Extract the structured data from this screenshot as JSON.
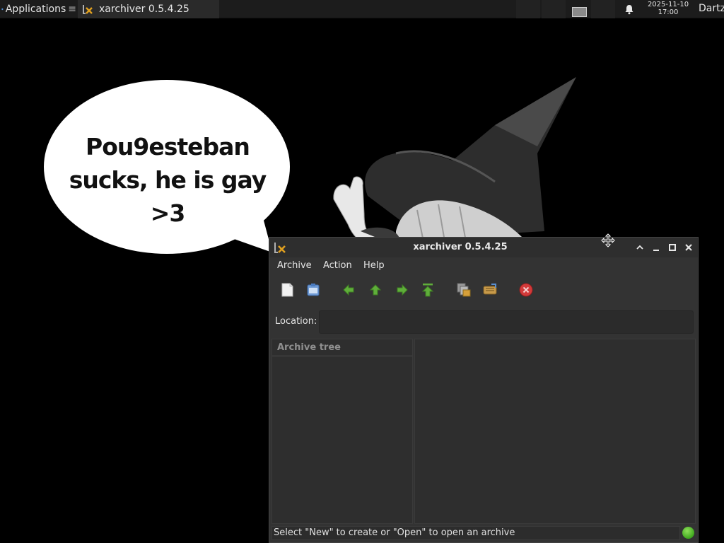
{
  "panel": {
    "apps_label": "Applications",
    "task_title": "xarchiver 0.5.4.25",
    "clock_date": "2025-11-10",
    "clock_time": "17:00",
    "user": "Dartz"
  },
  "wallpaper": {
    "bubble_line1": "Pou9esteban",
    "bubble_line2": "sucks, he is gay >3"
  },
  "window": {
    "title": "xarchiver 0.5.4.25",
    "menu": {
      "archive": "Archive",
      "action": "Action",
      "help": "Help"
    },
    "location_label": "Location:",
    "location_value": "",
    "tree_header": "Archive tree",
    "status_text": "Select \"New\" to create or \"Open\" to open an archive"
  },
  "icons": {
    "new": "new-archive-icon",
    "open": "open-archive-icon",
    "back": "back-arrow-icon",
    "up": "up-arrow-icon",
    "forward": "forward-arrow-icon",
    "home": "home-icon",
    "extract": "extract-icon",
    "add": "add-files-icon",
    "stop": "stop-icon"
  },
  "colors": {
    "arrow_green": "#5fae3a",
    "stop_red": "#d33a3a",
    "status_led": "#4cbf24"
  }
}
